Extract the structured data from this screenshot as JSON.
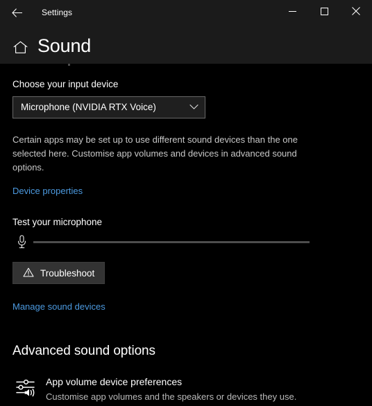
{
  "window": {
    "app_title": "Settings",
    "back_icon": "back-arrow-icon",
    "minimize_icon": "minimize-icon",
    "maximize_icon": "maximize-icon",
    "close_icon": "close-icon"
  },
  "header": {
    "home_icon": "home-icon",
    "title": "Sound"
  },
  "input_device": {
    "label": "Choose your input device",
    "selected": "Microphone (NVIDIA RTX Voice)",
    "chevron_icon": "chevron-down-icon",
    "description": "Certain apps may be set up to use different sound devices than the one selected here. Customise app volumes and devices in advanced sound options.",
    "device_properties_link": "Device properties"
  },
  "microphone_test": {
    "label": "Test your microphone",
    "mic_icon": "microphone-icon",
    "level_percent": 0,
    "troubleshoot_label": "Troubleshoot",
    "troubleshoot_icon": "warning-triangle-icon"
  },
  "manage_sound_devices_link": "Manage sound devices",
  "advanced": {
    "title": "Advanced sound options",
    "items": [
      {
        "icon": "app-volume-mixer-icon",
        "name": "App volume  device preferences",
        "sub": "Customise app volumes and the speakers or devices they use."
      }
    ]
  },
  "colors": {
    "accent_link": "#4c9ae0",
    "titlebar_bg": "#1b1b1b",
    "page_bg": "#000000",
    "button_bg": "#333333",
    "level_track": "#4d4d4d"
  }
}
